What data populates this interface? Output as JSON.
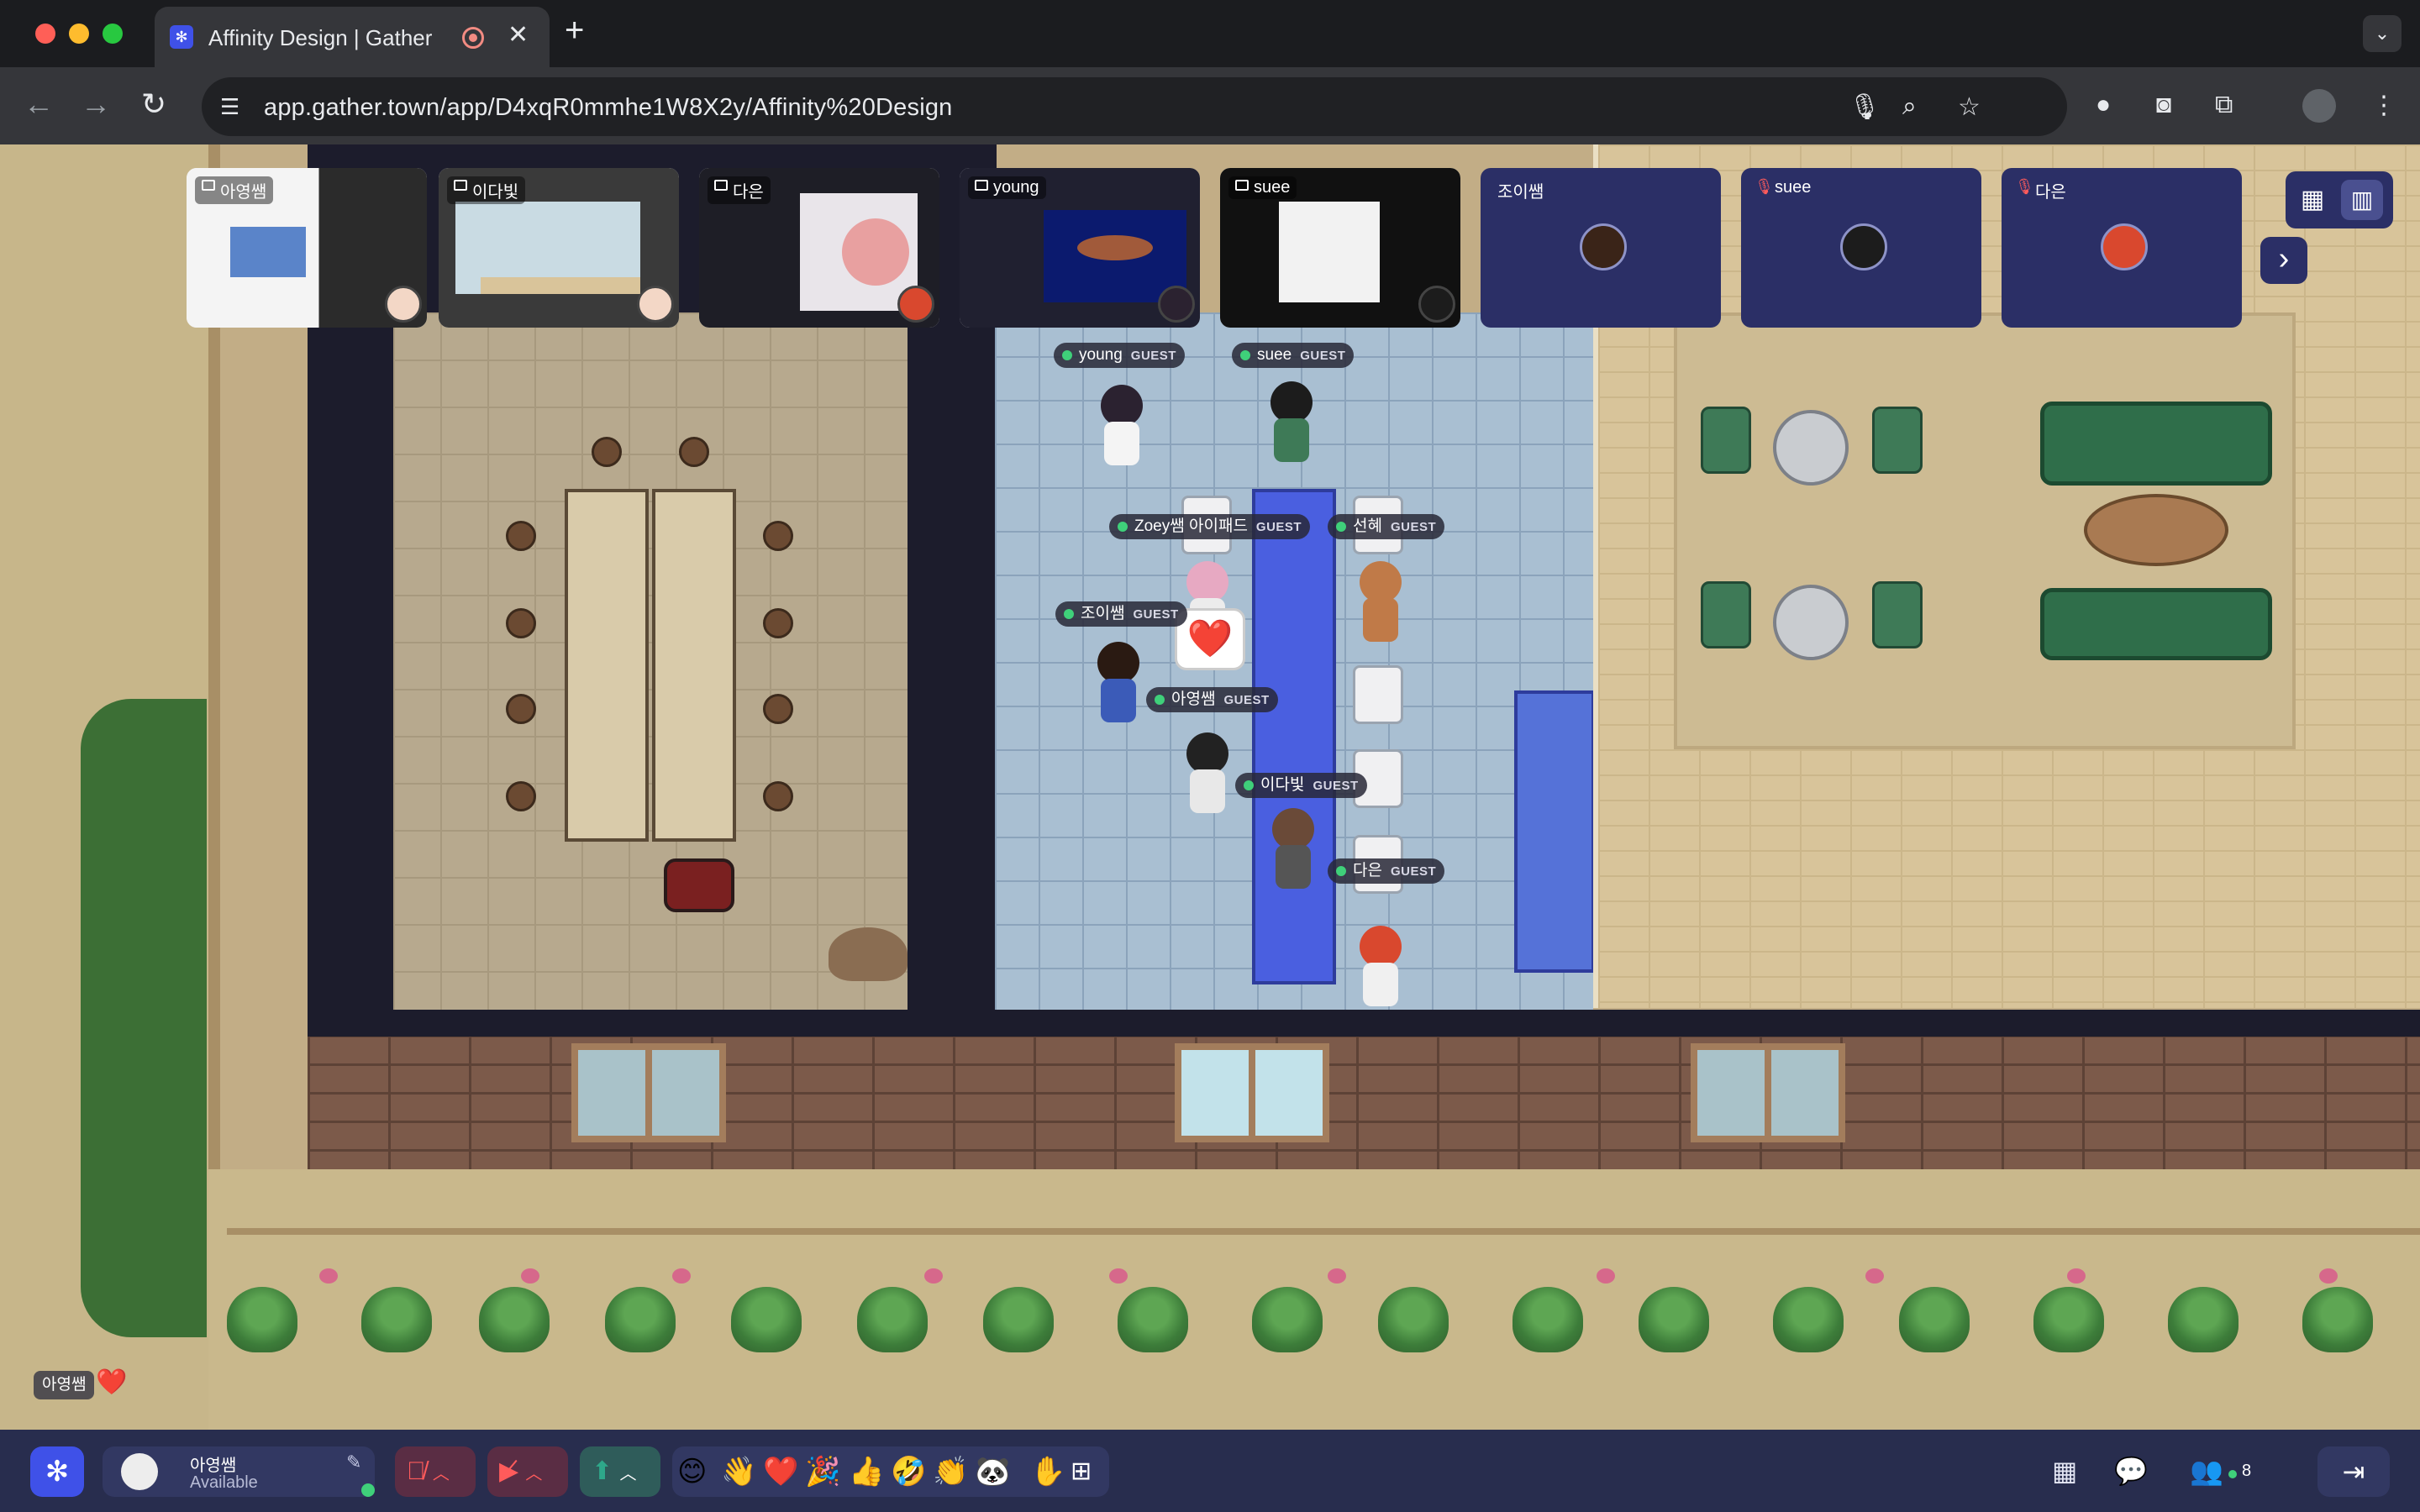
{
  "browser": {
    "tab_title": "Affinity Design | Gather",
    "tab_close": "✕",
    "new_tab": "+",
    "tab_menu": "⌄",
    "url": "app.gather.town/app/D4xqR0mmhe1W8X2y/Affinity%20Design",
    "nav": {
      "back": "←",
      "forward": "→",
      "reload": "↻"
    }
  },
  "video_strip": {
    "screen_shares": [
      {
        "name": "아영쌤"
      },
      {
        "name": "이다빛"
      },
      {
        "name": "다은"
      },
      {
        "name": "young"
      },
      {
        "name": "suee"
      }
    ],
    "cameras": [
      {
        "name": "조이쌤",
        "muted": false
      },
      {
        "name": "suee",
        "muted": true
      },
      {
        "name": "다은",
        "muted": true
      }
    ],
    "next_label": "›"
  },
  "players": [
    {
      "name": "young",
      "tag": "GUEST"
    },
    {
      "name": "suee",
      "tag": "GUEST"
    },
    {
      "name": "Zoey쌤 아이패드",
      "tag": "GUEST"
    },
    {
      "name": "선혜",
      "tag": "GUEST"
    },
    {
      "name": "조이쌤",
      "tag": "GUEST"
    },
    {
      "name": "아영쌤",
      "tag": "GUEST"
    },
    {
      "name": "이다빛",
      "tag": "GUEST"
    },
    {
      "name": "다은",
      "tag": "GUEST"
    }
  ],
  "reaction": {
    "emoji": "❤️"
  },
  "chat_toast": {
    "name": "아영쌤",
    "emoji": "❤️"
  },
  "bottom_bar": {
    "user_name": "아영쌤",
    "status": "Available",
    "emotes": [
      "😊",
      "👋",
      "❤️",
      "🎉",
      "👍",
      "🤣",
      "👏",
      "🐼"
    ],
    "participant_count": "8"
  },
  "colors": {
    "accent": "#3f51e8",
    "bottom_bar": "#282d4e",
    "mic_off": "#ff5b5b",
    "screen_share_active": "#2ea88a"
  }
}
